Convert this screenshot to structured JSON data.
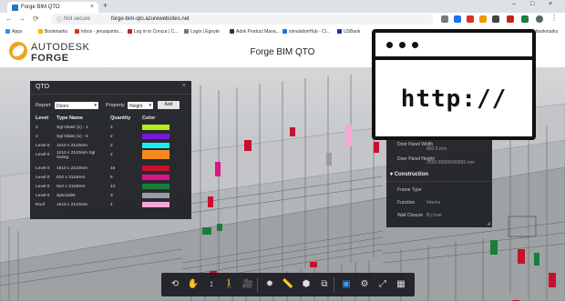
{
  "browser": {
    "tab_title": "Forge BIM QTO",
    "tab_close": "×",
    "new_tab": "+",
    "window_controls": [
      "–",
      "□",
      "×"
    ],
    "nav": {
      "back": "←",
      "forward": "→",
      "reload": "⟳"
    },
    "security_label": "Not secure",
    "url": "forge-bim-qto.azurewebsites.net",
    "bookmarks": [
      {
        "label": "Apps",
        "icon": "apps-grid-icon"
      },
      {
        "label": "Bookmarks",
        "icon": "star-icon"
      },
      {
        "label": "Inbox - jerusquints...",
        "icon": "mail-icon"
      },
      {
        "label": "Log in to Concur | C...",
        "icon": "concur-icon"
      },
      {
        "label": "Login | Egnyte",
        "icon": "egnyte-icon"
      },
      {
        "label": "Adsk Product Mana...",
        "icon": "autodesk-icon"
      },
      {
        "label": "simulationHub - Cl...",
        "icon": "simulationhub-icon"
      },
      {
        "label": "USBank",
        "icon": "bank-icon"
      },
      {
        "label": "er bookmarks",
        "icon": "folder-icon"
      }
    ]
  },
  "header": {
    "brand_line1": "AUTODESK",
    "brand_line2": "FORGE",
    "title": "Forge BIM QTO"
  },
  "qto_panel": {
    "title": "QTO",
    "close": "×",
    "report_label": "Report",
    "report_value": "Doors",
    "property_label": "Property",
    "property_value": "Height",
    "add_label": "Add",
    "columns": [
      "Level",
      "Type Name",
      "Quantity",
      "Color"
    ],
    "rows": [
      {
        "level": "2",
        "type": "Sgl Glass (1) - 1",
        "qty": "2",
        "color": "#b4ef17"
      },
      {
        "level": "2",
        "type": "Sgl Glass (1) - 6",
        "qty": "2",
        "color": "#7a18d8"
      },
      {
        "level": "Level 0",
        "type": "1010 x 2110mm",
        "qty": "2",
        "color": "#19eef4"
      },
      {
        "level": "Level 0",
        "type": "1210 x 2110mm Sgl Swing",
        "qty": "2",
        "color": "#f68a1e"
      },
      {
        "level": "Level 0",
        "type": "1610 x 2110mm",
        "qty": "16",
        "color": "#c8102e"
      },
      {
        "level": "Level 0",
        "type": "810 x 2110mm",
        "qty": "5",
        "color": "#e0138a"
      },
      {
        "level": "Level 0",
        "type": "910 x 2110mm",
        "qty": "14",
        "color": "#1b7d3a"
      },
      {
        "level": "Level 0",
        "type": "Specialist",
        "qty": "3",
        "color": "#9c9aa8"
      },
      {
        "level": "Roof",
        "type": "1610 x 2110mm",
        "qty": "1",
        "color": "#f7a6d6"
      }
    ]
  },
  "properties_panel": {
    "rows": [
      {
        "key": "Door Panel Width",
        "value": "860.5 mm"
      },
      {
        "key": "Door Panel Height",
        "value": "2099.99999999995 mm"
      }
    ],
    "section": "Construction",
    "section_rows": [
      {
        "key": "Frame Type",
        "value": ""
      },
      {
        "key": "Function",
        "value": "Interior"
      },
      {
        "key": "Wall Closure",
        "value": "By host"
      }
    ]
  },
  "overlay_card": {
    "text": "http://"
  },
  "viewer_toolbar": {
    "buttons": [
      {
        "name": "orbit-icon",
        "glyph": "⟲"
      },
      {
        "name": "pan-icon",
        "glyph": "✋"
      },
      {
        "name": "zoom-icon",
        "glyph": "↕"
      },
      {
        "name": "first-person-icon",
        "glyph": "🚶"
      },
      {
        "name": "camera-icon",
        "glyph": "🎥"
      },
      {
        "name": "explode-icon",
        "glyph": "✸"
      },
      {
        "name": "measure-icon",
        "glyph": "📏"
      },
      {
        "name": "section-icon",
        "glyph": "⬢"
      },
      {
        "name": "model-browser-icon",
        "glyph": "⧉"
      },
      {
        "name": "properties-icon",
        "glyph": "▣"
      },
      {
        "name": "settings-icon",
        "glyph": "⚙"
      },
      {
        "name": "fullscreen-icon",
        "glyph": "⤢"
      },
      {
        "name": "qto-table-icon",
        "glyph": "▦"
      }
    ]
  }
}
